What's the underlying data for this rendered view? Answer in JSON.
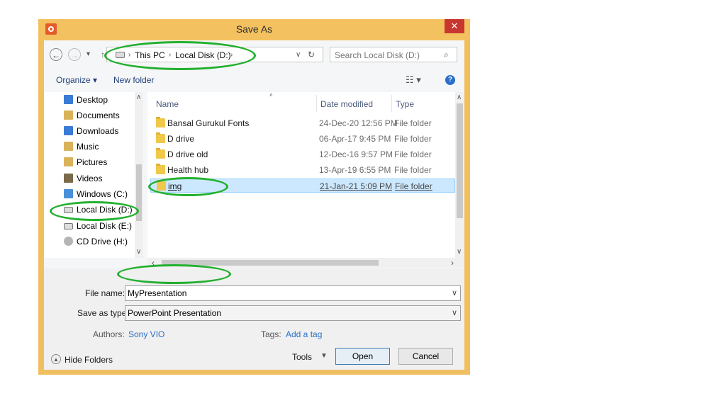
{
  "window": {
    "title": "Save As",
    "close_glyph": "✕",
    "app_icon": "powerpoint-icon"
  },
  "address": {
    "crumbs": [
      "This PC",
      "Local Disk (D:)"
    ],
    "search_placeholder": "Search Local Disk (D:)"
  },
  "toolbar": {
    "organize_label": "Organize ▾",
    "new_folder_label": "New folder"
  },
  "nav_pane": {
    "items": [
      {
        "label": "Desktop",
        "icon": "desktop-icon",
        "color": "#3a7bd5"
      },
      {
        "label": "Documents",
        "icon": "documents-icon",
        "color": "#d9b25a"
      },
      {
        "label": "Downloads",
        "icon": "downloads-icon",
        "color": "#3a7bd5"
      },
      {
        "label": "Music",
        "icon": "music-icon",
        "color": "#d9b25a"
      },
      {
        "label": "Pictures",
        "icon": "pictures-icon",
        "color": "#d9b25a"
      },
      {
        "label": "Videos",
        "icon": "videos-icon",
        "color": "#7a6a4a"
      },
      {
        "label": "Windows (C:)",
        "icon": "windows-drive-icon",
        "color": "#4a8fd9"
      },
      {
        "label": "Local Disk (D:)",
        "icon": "drive-icon",
        "color": "#999999"
      },
      {
        "label": "Local Disk (E:)",
        "icon": "drive-icon",
        "color": "#999999"
      },
      {
        "label": "CD Drive (H:)",
        "icon": "cd-drive-icon",
        "color": "#999999"
      }
    ]
  },
  "file_list": {
    "columns": [
      "Name",
      "Date modified",
      "Type"
    ],
    "rows": [
      {
        "name": "Bansal Gurukul Fonts",
        "date": "24-Dec-20 12:56 PM",
        "type": "File folder"
      },
      {
        "name": "D drive",
        "date": "06-Apr-17 9:45 PM",
        "type": "File folder"
      },
      {
        "name": "D drive old",
        "date": "12-Dec-16 9:57 PM",
        "type": "File folder"
      },
      {
        "name": "Health hub",
        "date": "13-Apr-19 6:55 PM",
        "type": "File folder"
      },
      {
        "name": "img",
        "date": "21-Jan-21 5:09 PM",
        "type": "File folder",
        "selected": true
      }
    ]
  },
  "form": {
    "file_name_label": "File name:",
    "file_name_value": "MyPresentation",
    "save_as_type_label": "Save as type:",
    "save_as_type_value": "PowerPoint Presentation",
    "authors_label": "Authors:",
    "authors_value": "Sony VIO",
    "tags_label": "Tags:",
    "tags_value": "Add a tag"
  },
  "footer": {
    "hide_folders_label": "Hide Folders",
    "tools_label": "Tools",
    "open_label": "Open",
    "cancel_label": "Cancel"
  },
  "colors": {
    "titlebar": "#f3c15f",
    "close": "#c7372f",
    "highlight_ring": "#23b02f",
    "link": "#2a6fc7"
  }
}
